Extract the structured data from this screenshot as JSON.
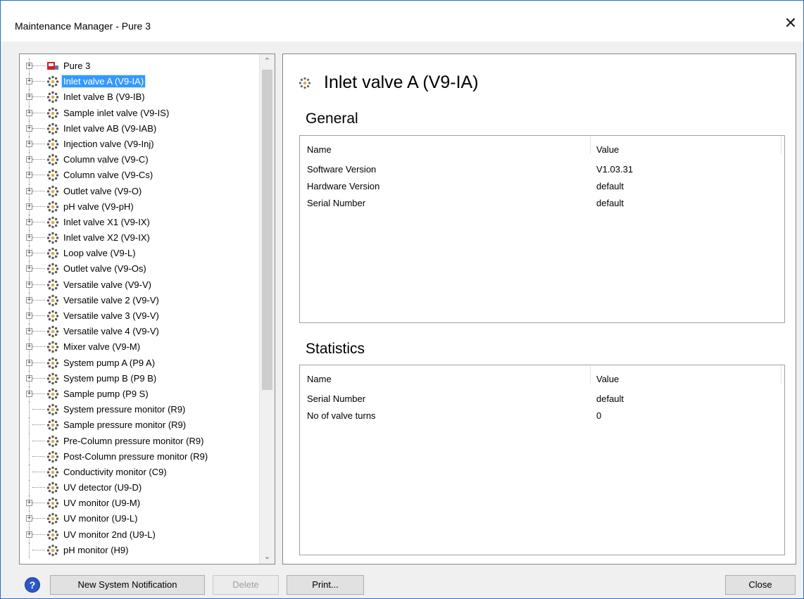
{
  "window": {
    "title": "Maintenance Manager - Pure 3",
    "close_glyph": "✕"
  },
  "tree": {
    "items": [
      {
        "label": "Pure 3",
        "icon": "system-icon",
        "expandable": true,
        "selected": false
      },
      {
        "label": "Inlet valve A (V9-IA)",
        "icon": "module-icon",
        "expandable": true,
        "selected": true
      },
      {
        "label": "Inlet valve B (V9-IB)",
        "icon": "module-icon",
        "expandable": true,
        "selected": false
      },
      {
        "label": "Sample inlet valve (V9-IS)",
        "icon": "module-icon",
        "expandable": true,
        "selected": false
      },
      {
        "label": "Inlet valve AB (V9-IAB)",
        "icon": "module-icon",
        "expandable": true,
        "selected": false
      },
      {
        "label": "Injection valve (V9-Inj)",
        "icon": "module-icon",
        "expandable": true,
        "selected": false
      },
      {
        "label": "Column valve (V9-C)",
        "icon": "module-icon",
        "expandable": true,
        "selected": false
      },
      {
        "label": "Column valve (V9-Cs)",
        "icon": "module-icon",
        "expandable": true,
        "selected": false
      },
      {
        "label": "Outlet valve (V9-O)",
        "icon": "module-icon",
        "expandable": true,
        "selected": false
      },
      {
        "label": "pH valve (V9-pH)",
        "icon": "module-icon",
        "expandable": true,
        "selected": false
      },
      {
        "label": "Inlet valve X1 (V9-IX)",
        "icon": "module-icon",
        "expandable": true,
        "selected": false
      },
      {
        "label": "Inlet valve X2 (V9-IX)",
        "icon": "module-icon",
        "expandable": true,
        "selected": false
      },
      {
        "label": "Loop valve (V9-L)",
        "icon": "module-icon",
        "expandable": true,
        "selected": false
      },
      {
        "label": "Outlet valve (V9-Os)",
        "icon": "module-icon",
        "expandable": true,
        "selected": false
      },
      {
        "label": "Versatile valve (V9-V)",
        "icon": "module-icon",
        "expandable": true,
        "selected": false
      },
      {
        "label": "Versatile valve 2 (V9-V)",
        "icon": "module-icon",
        "expandable": true,
        "selected": false
      },
      {
        "label": "Versatile valve 3 (V9-V)",
        "icon": "module-icon",
        "expandable": true,
        "selected": false
      },
      {
        "label": "Versatile valve 4 (V9-V)",
        "icon": "module-icon",
        "expandable": true,
        "selected": false
      },
      {
        "label": "Mixer valve (V9-M)",
        "icon": "module-icon",
        "expandable": true,
        "selected": false
      },
      {
        "label": "System pump A (P9 A)",
        "icon": "module-icon",
        "expandable": true,
        "selected": false
      },
      {
        "label": "System pump B (P9 B)",
        "icon": "module-icon",
        "expandable": true,
        "selected": false
      },
      {
        "label": "Sample pump (P9 S)",
        "icon": "module-icon",
        "expandable": true,
        "selected": false
      },
      {
        "label": "System pressure monitor (R9)",
        "icon": "module-icon",
        "expandable": false,
        "selected": false
      },
      {
        "label": "Sample pressure monitor (R9)",
        "icon": "module-icon",
        "expandable": false,
        "selected": false
      },
      {
        "label": "Pre-Column pressure monitor (R9)",
        "icon": "module-icon",
        "expandable": false,
        "selected": false
      },
      {
        "label": "Post-Column pressure monitor (R9)",
        "icon": "module-icon",
        "expandable": false,
        "selected": false
      },
      {
        "label": "Conductivity monitor (C9)",
        "icon": "module-icon",
        "expandable": false,
        "selected": false
      },
      {
        "label": "UV detector (U9-D)",
        "icon": "module-icon",
        "expandable": false,
        "selected": false
      },
      {
        "label": "UV monitor (U9-M)",
        "icon": "module-icon",
        "expandable": true,
        "selected": false
      },
      {
        "label": "UV monitor (U9-L)",
        "icon": "module-icon",
        "expandable": true,
        "selected": false
      },
      {
        "label": "UV monitor 2nd (U9-L)",
        "icon": "module-icon",
        "expandable": true,
        "selected": false
      },
      {
        "label": "pH monitor (H9)",
        "icon": "module-icon",
        "expandable": false,
        "selected": false
      }
    ],
    "scroll_up_glyph": "⌃",
    "scroll_down_glyph": "⌄"
  },
  "details": {
    "title": "Inlet valve A (V9-IA)",
    "general": {
      "heading": "General",
      "col_name": "Name",
      "col_value": "Value",
      "rows": [
        {
          "name": "Software Version",
          "value": "V1.03.31"
        },
        {
          "name": "Hardware Version",
          "value": "default"
        },
        {
          "name": "Serial Number",
          "value": "default"
        }
      ]
    },
    "statistics": {
      "heading": "Statistics",
      "col_name": "Name",
      "col_value": "Value",
      "rows": [
        {
          "name": "Serial Number",
          "value": "default"
        },
        {
          "name": "No of valve turns",
          "value": "0"
        }
      ]
    }
  },
  "buttons": {
    "help": "?",
    "new_notification": "New System Notification",
    "delete": "Delete",
    "print": "Print...",
    "close": "Close"
  },
  "colors": {
    "selection": "#3399ff",
    "window_border": "#1e6fd0",
    "module_icon_dots": "#5a5a5a",
    "system_icon_red": "#d21f26"
  }
}
